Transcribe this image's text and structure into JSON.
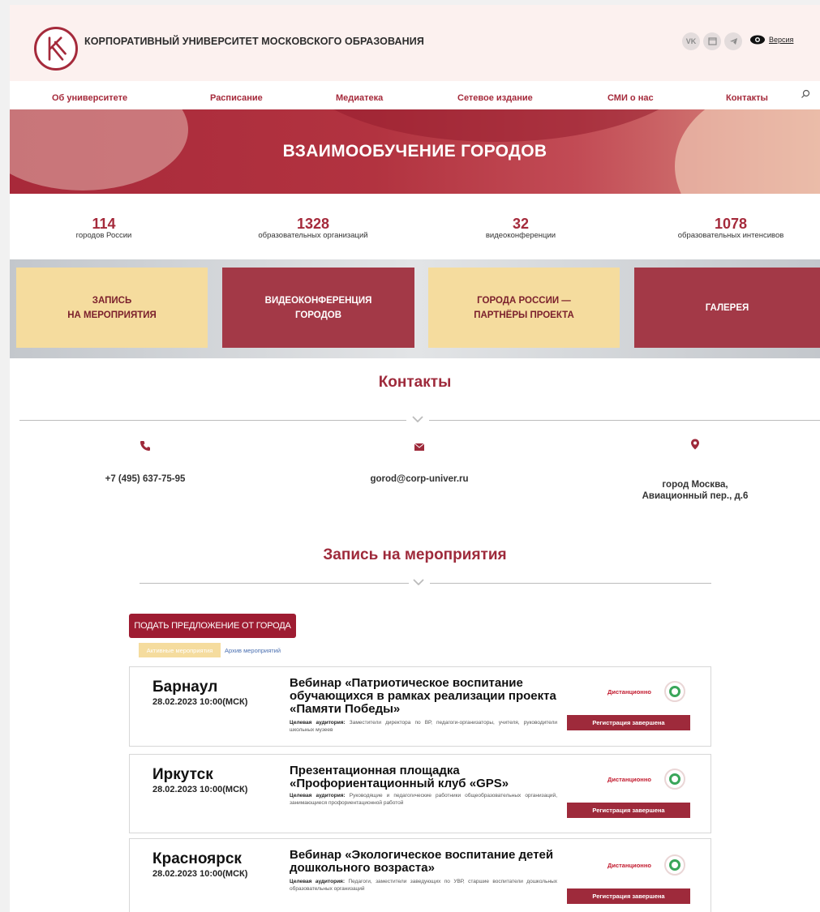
{
  "header": {
    "site_title": "КОРПОРАТИВНЫЙ УНИВЕРСИТЕТ МОСКОВСКОГО ОБРАЗОВАНИЯ",
    "logo_letter": "К",
    "socials": [
      {
        "icon": "vk-icon",
        "label": "VK"
      },
      {
        "icon": "window-icon",
        "label": ""
      },
      {
        "icon": "telegram-icon",
        "label": ""
      }
    ],
    "version_label": "Версия"
  },
  "nav": {
    "items": [
      "Об университете",
      "Расписание",
      "Медиатека",
      "Сетевое издание",
      "СМИ о нас",
      "Контакты"
    ],
    "search_icon": "search-icon"
  },
  "banner": {
    "title": "ВЗАИМООБУЧЕНИЕ ГОРОДОВ"
  },
  "stats": [
    {
      "value": "114",
      "label": "городов России"
    },
    {
      "value": "1328",
      "label": "образовательных организаций"
    },
    {
      "value": "32",
      "label": "видеоконференции"
    },
    {
      "value": "1078",
      "label": "образовательных интенсивов"
    }
  ],
  "tiles": [
    {
      "label": "ЗАПИСЬ\nНА МЕРОПРИЯТИЯ"
    },
    {
      "label": "ВИДЕОКОНФЕРЕНЦИЯ\nГОРОДОВ"
    },
    {
      "label": "ГОРОДА РОССИИ —\nПАРТНЁРЫ ПРОЕКТА"
    },
    {
      "label": "ГАЛЕРЕЯ"
    }
  ],
  "contacts": {
    "title": "Контакты",
    "phone": "+7 (495) 637-75-95",
    "email": "gorod@corp-univer.ru",
    "address_line1": "город Москва,",
    "address_line2": "Авиационный пер., д.6"
  },
  "events": {
    "title": "Запись на мероприятия",
    "propose_button": "ПОДАТЬ ПРЕДЛОЖЕНИЕ ОТ ГОРОДА",
    "tab_active": "Активные мероприятия",
    "tab_archive": "Архив мероприятий",
    "audience_label": "Целевая аудитория:",
    "items": [
      {
        "city": "Барнаул",
        "date": "28.02.2023 10:00(МСК)",
        "title": "Вебинар «Патриотическое воспитание обучающихся в рамках реализации проекта «Памяти Победы»",
        "audience": "Заместители директора по ВР, педагоги-организаторы, учителя, руководители школьных музеев",
        "mode": "Дистанционно",
        "status": "Регистрация завершена"
      },
      {
        "city": "Иркутск",
        "date": "28.02.2023 10:00(МСК)",
        "title": "Презентационная площадка «Профориентационный клуб «GPS»",
        "audience": "Руководящие и педагогические работники общеобразовательных организаций, занимающиеся профориентационной работой",
        "mode": "Дистанционно",
        "status": "Регистрация завершена"
      },
      {
        "city": "Красноярск",
        "date": "28.02.2023 10:00(МСК)",
        "title": "Вебинар «Экологическое воспитание детей дошкольного возраста»",
        "audience": "Педагоги, заместители заведующих по УВР, старшие воспитатели дошкольных образовательных организаций",
        "mode": "Дистанционно",
        "status": "Регистрация завершена"
      }
    ]
  },
  "colors": {
    "brand": "#a52a3b",
    "accent_light": "#f5dc9e",
    "status_ok": "#3aa65a"
  }
}
